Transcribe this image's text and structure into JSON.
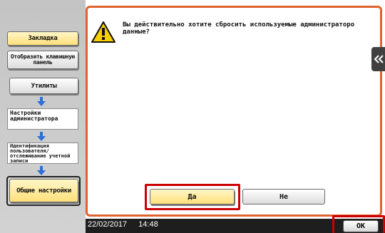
{
  "sidebar": {
    "bookmark_label": "Закладка",
    "keypad_label": "Отобразить клавишную панель",
    "breadcrumb": [
      {
        "label": "Утилиты"
      },
      {
        "label": "Настройки администратора"
      },
      {
        "label": "Идентификация пользователя/ отслеживание учетной записи"
      },
      {
        "label": "Общие настройки"
      }
    ]
  },
  "dialog": {
    "message": "Вы действительно хотите сбросить используемые администраторо данные?",
    "yes_label": "Да",
    "no_label": "Не"
  },
  "statusbar": {
    "date": "22/02/2017",
    "time": "14:48",
    "ok_label": "OK"
  },
  "icons": {
    "warning": "warning-icon",
    "down_arrow": "arrow-down-icon",
    "side_tab": "double-chevron-left-icon"
  },
  "colors": {
    "panel_border": "#e0632e",
    "highlight": "#cc0000",
    "selected_button": "#ffe07a",
    "arrow": "#2f6fd6"
  }
}
